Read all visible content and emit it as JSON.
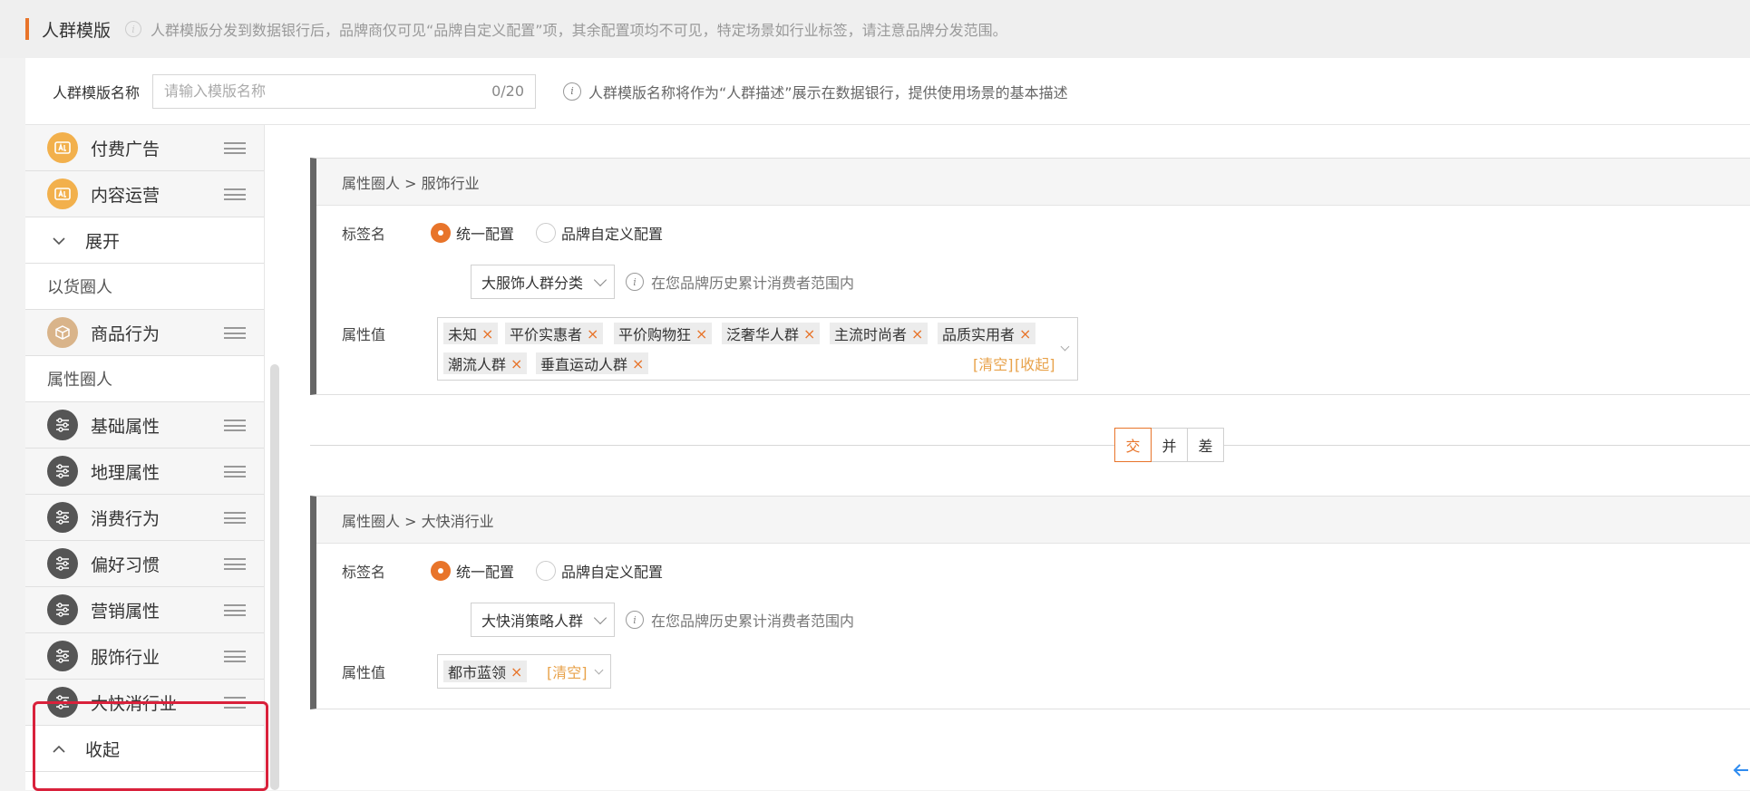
{
  "header": {
    "title": "人群模版",
    "tip": "人群模版分发到数据银行后，品牌商仅可见“品牌自定义配置”项，其余配置项均不可见，特定场景如行业标签，请注意品牌分发范围。"
  },
  "name_row": {
    "label": "人群模版名称",
    "placeholder": "请输入模版名称",
    "value": "",
    "count": "0/20",
    "description": "人群模版名称将作为“人群描述”展示在数据银行，提供使用场景的基本描述"
  },
  "sidebar": {
    "items": [
      {
        "type": "item",
        "label": "付费广告",
        "icon": "ad-icon"
      },
      {
        "type": "item",
        "label": "内容运营",
        "icon": "content-icon"
      },
      {
        "type": "toggle",
        "label": "展开"
      },
      {
        "type": "header",
        "label": "以货圈人"
      },
      {
        "type": "item",
        "label": "商品行为",
        "icon": "box-icon"
      },
      {
        "type": "header",
        "label": "属性圈人"
      },
      {
        "type": "item",
        "label": "基础属性",
        "icon": "sliders-icon"
      },
      {
        "type": "item",
        "label": "地理属性",
        "icon": "sliders-icon"
      },
      {
        "type": "item",
        "label": "消费行为",
        "icon": "sliders-icon"
      },
      {
        "type": "item",
        "label": "偏好习惯",
        "icon": "sliders-icon"
      },
      {
        "type": "item",
        "label": "营销属性",
        "icon": "sliders-icon"
      },
      {
        "type": "item",
        "label": "服饰行业",
        "icon": "sliders-icon"
      },
      {
        "type": "item",
        "label": "大快消行业",
        "icon": "sliders-icon"
      },
      {
        "type": "toggle",
        "label": "收起"
      }
    ]
  },
  "cards": [
    {
      "breadcrumb": "属性圈人 > 服饰行业",
      "tag_name_label": "标签名",
      "radio_unified": "统一配置",
      "radio_custom": "品牌自定义配置",
      "select_value": "大服饰人群分类",
      "hint": "在您品牌历史累计消费者范围内",
      "attr_label": "属性值",
      "tags": [
        "未知",
        "平价实惠者",
        "平价购物狂",
        "泛奢华人群",
        "主流时尚者",
        "品质实用者",
        "潮流人群",
        "垂直运动人群"
      ],
      "clear_label": "[清空]",
      "collapse_label": "[收起]"
    },
    {
      "breadcrumb": "属性圈人 > 大快消行业",
      "tag_name_label": "标签名",
      "radio_unified": "统一配置",
      "radio_custom": "品牌自定义配置",
      "select_value": "大快消策略人群",
      "hint": "在您品牌历史累计消费者范围内",
      "attr_label": "属性值",
      "tags": [
        "都市蓝领"
      ],
      "clear_label": "[清空]"
    }
  ],
  "operators": [
    "交",
    "并",
    "差"
  ],
  "tag_remove_glyph": "×",
  "colors": {
    "accent": "#e8742a",
    "highlight": "#d9213b",
    "card_border": "#666666"
  }
}
